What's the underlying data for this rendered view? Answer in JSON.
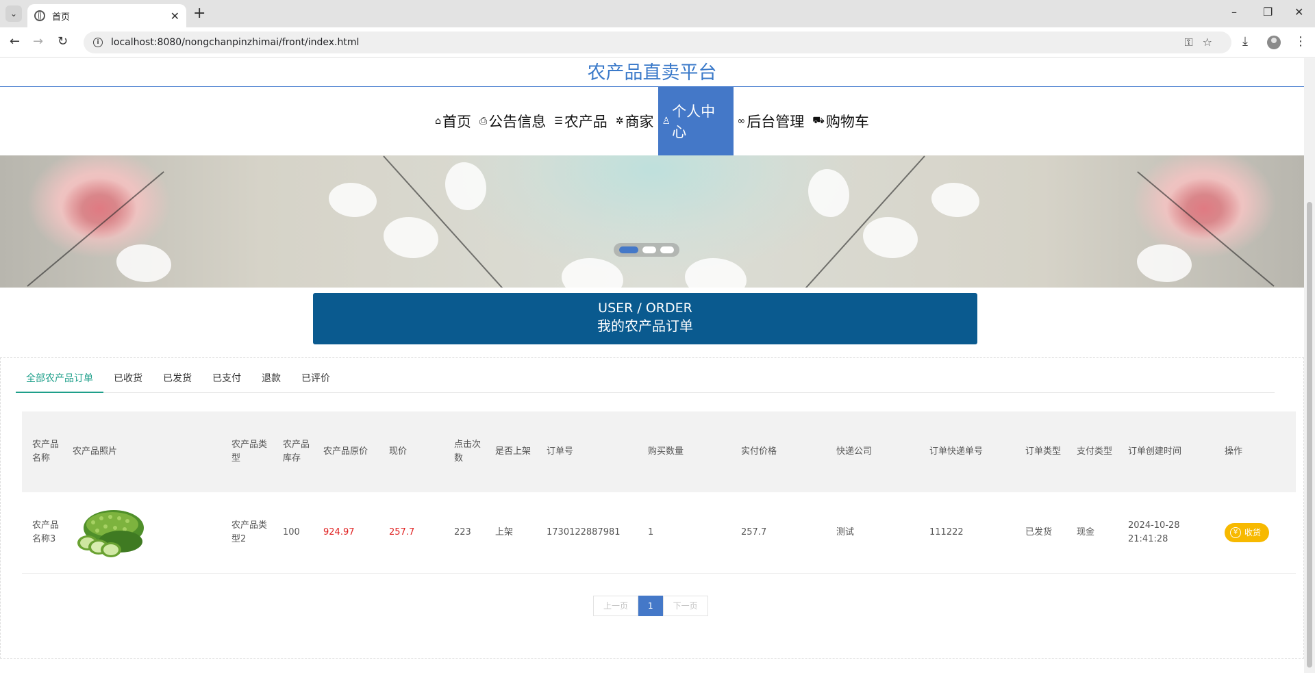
{
  "browser": {
    "tab_title": "首页",
    "new_tab": "+",
    "url": "localhost:8080/nongchanpinzhimai/front/index.html",
    "window_controls": {
      "minimize": "–",
      "restore": "❐",
      "close": "✕"
    }
  },
  "site": {
    "title": "农产品直卖平台",
    "nav": [
      {
        "icon": "home-icon",
        "glyph": "⌂",
        "label": "首页"
      },
      {
        "icon": "notice-icon",
        "glyph": "⎙",
        "label": "公告信息"
      },
      {
        "icon": "layers-icon",
        "glyph": "☰",
        "label": "农产品"
      },
      {
        "icon": "merchant-icon",
        "glyph": "✲",
        "label": "商家"
      },
      {
        "icon": "user-icon",
        "glyph": "♙",
        "label": "个人中心",
        "active": true
      },
      {
        "icon": "link-icon",
        "glyph": "∞",
        "label": "后台管理"
      },
      {
        "icon": "cart-icon",
        "glyph": "⛟",
        "label": "购物车"
      }
    ],
    "nav_active_color": "#4478c8",
    "banner_slides": 3,
    "banner_active_slide": 1
  },
  "section": {
    "en": "USER / ORDER",
    "cn": "我的农产品订单",
    "color": "#0a5a8f"
  },
  "order_tabs": [
    {
      "label": "全部农产品订单",
      "active": true
    },
    {
      "label": "已收货"
    },
    {
      "label": "已发货"
    },
    {
      "label": "已支付"
    },
    {
      "label": "退款"
    },
    {
      "label": "已评价"
    }
  ],
  "table": {
    "headers": [
      "农产品名称",
      "农产品照片",
      "农产品类型",
      "农产品库存",
      "农产品原价",
      "现价",
      "点击次数",
      "是否上架",
      "订单号",
      "购买数量",
      "实付价格",
      "快递公司",
      "订单快递单号",
      "订单类型",
      "支付类型",
      "订单创建时间",
      "操作"
    ],
    "rows": [
      {
        "name": "农产品名称3",
        "photo": "cucumber-photo",
        "type": "农产品类型2",
        "stock": "100",
        "orig_price": "924.97",
        "price": "257.7",
        "clicks": "223",
        "on_shelf": "上架",
        "order_no": "1730122887981",
        "qty": "1",
        "paid": "257.7",
        "courier": "测试",
        "tracking": "111222",
        "order_type": "已发货",
        "pay_type": "现金",
        "created": "2024-10-28 21:41:28",
        "action": "收货"
      }
    ]
  },
  "pager": {
    "prev": "上一页",
    "current": "1",
    "next": "下一页"
  },
  "colors": {
    "accent_green": "#1e9f8a",
    "price_red": "#e02020",
    "action_yellow": "#f7b900"
  }
}
